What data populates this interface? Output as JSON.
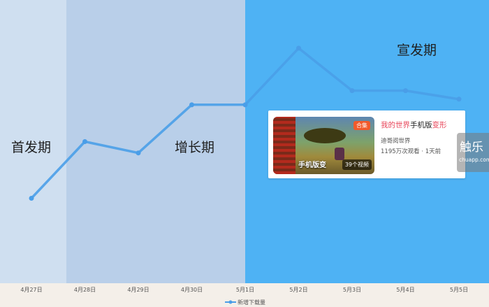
{
  "chart_data": {
    "type": "line",
    "categories": [
      "4月27日",
      "4月28日",
      "4月29日",
      "4月30日",
      "5月1日",
      "5月2日",
      "5月3日",
      "5月4日",
      "5月5日"
    ],
    "series": [
      {
        "name": "新增下载量",
        "values": [
          30,
          50,
          46,
          63,
          63,
          83,
          68,
          68,
          65
        ]
      }
    ],
    "ylim": [
      0,
      100
    ],
    "legend": "bottom-center",
    "grid": false,
    "phases": [
      {
        "label": "首发期"
      },
      {
        "label": "增长期"
      },
      {
        "label": "宣发期"
      }
    ]
  },
  "colors": {
    "series_line": "#4a9ee8",
    "phase1_bg": "#cfdff0",
    "phase2_bg": "#b9cfe9",
    "phase3_bg": "#4eb2f4"
  },
  "video_card": {
    "title_part1": "我的世界",
    "title_part2": "手机版",
    "title_part3": "变形",
    "author": "迪哥阅世界",
    "stats": "1195万次观看 · 1天前",
    "thumb_overlay": "手机版变",
    "tag": "合集",
    "count_badge": "39个视频"
  },
  "watermark": {
    "main": "触乐",
    "sub": "chuapp.com"
  }
}
